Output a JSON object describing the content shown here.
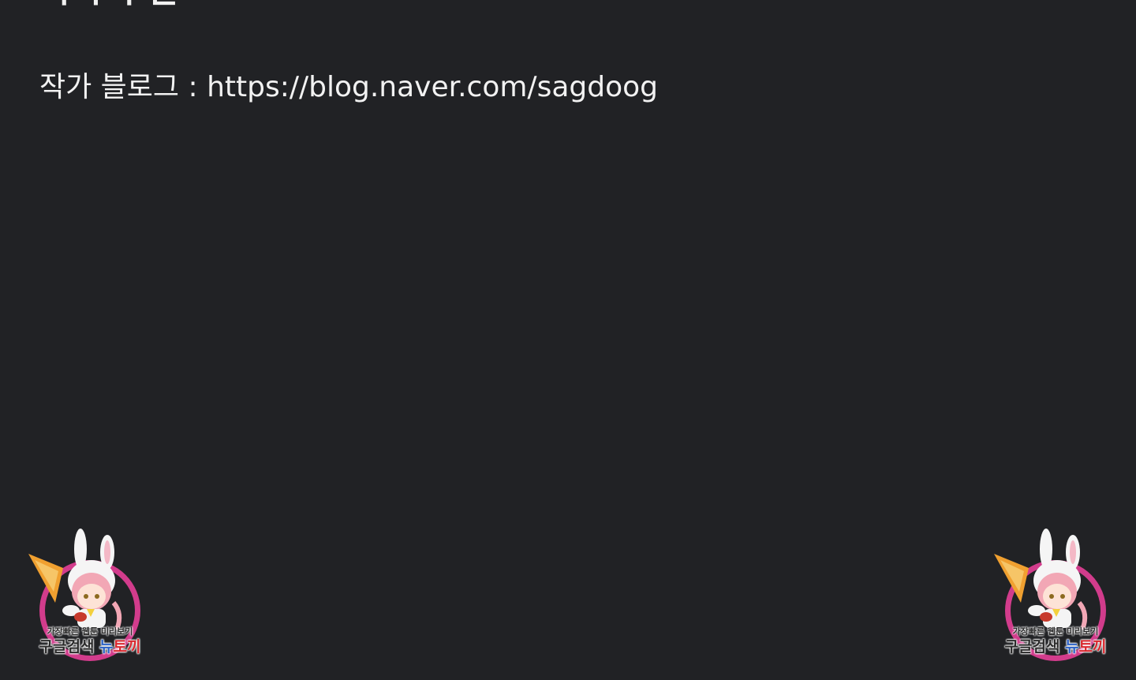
{
  "header": {
    "title_partial": "작가의 말"
  },
  "content": {
    "blog_label": "작가 블로그 : ",
    "blog_url": "https://blog.naver.com/sagdoog"
  },
  "watermark": {
    "tagline": "가장빠른 웹툰 미리보기",
    "prefix": "구글검색 ",
    "brand_blue": "뉴",
    "brand_red": "토끼",
    "colors": {
      "ring": "#d23c8c",
      "carrot": "#f0a030",
      "hair": "#f2a7b5",
      "brand_blue": "#2d63c8",
      "brand_red": "#d9272e"
    }
  }
}
